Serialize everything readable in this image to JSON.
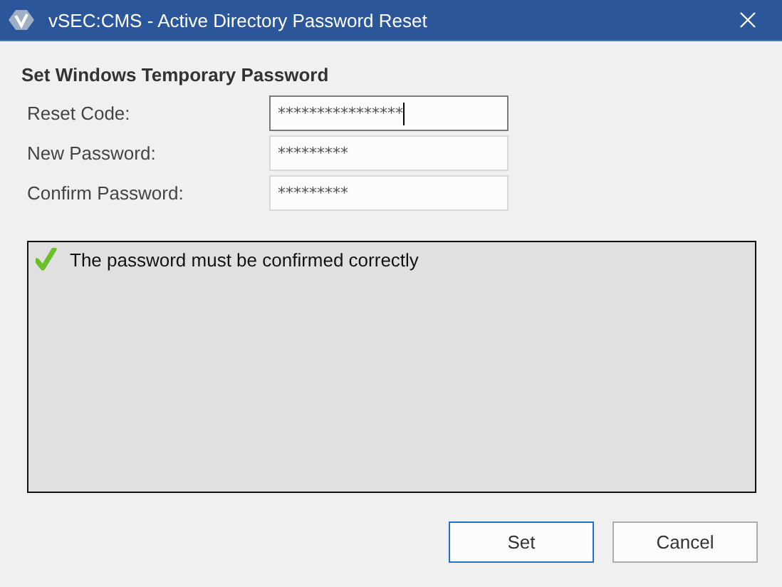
{
  "window": {
    "title": "vSEC:CMS - Active Directory Password Reset"
  },
  "heading": "Set Windows Temporary Password",
  "fields": [
    {
      "label": "Reset Code:",
      "value": "****************",
      "focused": true
    },
    {
      "label": "New Password:",
      "value": "*********",
      "focused": false
    },
    {
      "label": "Confirm Password:",
      "value": "*********",
      "focused": false
    }
  ],
  "messages": [
    {
      "kind": "ok",
      "text": "The password must be confirmed correctly"
    }
  ],
  "buttons": [
    {
      "label": "Set",
      "default": true
    },
    {
      "label": "Cancel",
      "default": false
    }
  ]
}
